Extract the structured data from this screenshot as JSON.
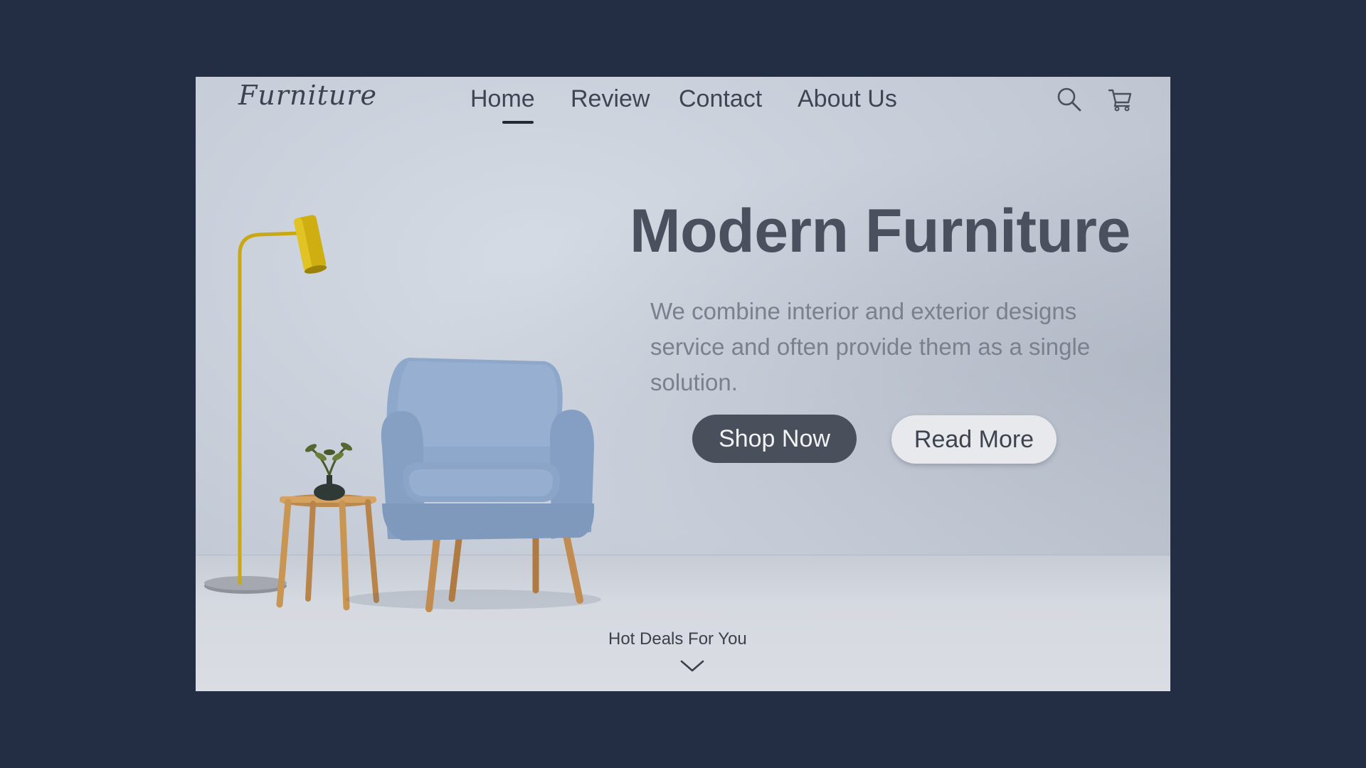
{
  "brand": {
    "logo_text": "Furniture"
  },
  "nav": {
    "items": [
      {
        "label": "Home",
        "active": true
      },
      {
        "label": "Review"
      },
      {
        "label": "Contact"
      },
      {
        "label": "About Us"
      }
    ],
    "icons": [
      "search-icon",
      "cart-icon"
    ]
  },
  "hero": {
    "title": "Modern Furniture",
    "description": "We combine interior and exterior designs service and often provide them as a single solution.",
    "primary_button": "Shop Now",
    "secondary_button": "Read More"
  },
  "footer_hint": {
    "label": "Hot Deals For You",
    "icon": "chevron-down-icon"
  },
  "colors": {
    "page_background": "#232d44",
    "primary_button": "#4a505b",
    "secondary_button": "#e7e9ec",
    "chair": "#8fa9cc",
    "lamp": "#d4b517"
  }
}
